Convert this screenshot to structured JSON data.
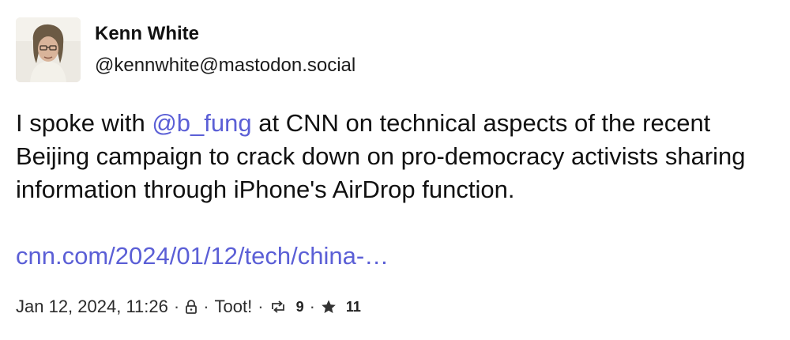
{
  "author": {
    "display_name": "Kenn White",
    "handle": "@kennwhite@mastodon.social"
  },
  "post": {
    "text_before_mention": "I spoke with ",
    "mention": "@b_fung",
    "text_after_mention": " at CNN on technical aspects of the recent Beijing campaign to crack down on pro-democracy activists sharing information through iPhone's AirDrop function.",
    "link_text": "cnn.com/2024/01/12/tech/china-…"
  },
  "meta": {
    "timestamp": "Jan 12, 2024, 11:26",
    "separator": "·",
    "visibility_icon": "lock-icon",
    "app": "Toot!",
    "boost_icon": "boost-icon",
    "boosts": "9",
    "favourite_icon": "star-icon",
    "favourites": "11"
  },
  "colors": {
    "link": "#5b5fd6",
    "text": "#111111",
    "background": "#ffffff"
  }
}
